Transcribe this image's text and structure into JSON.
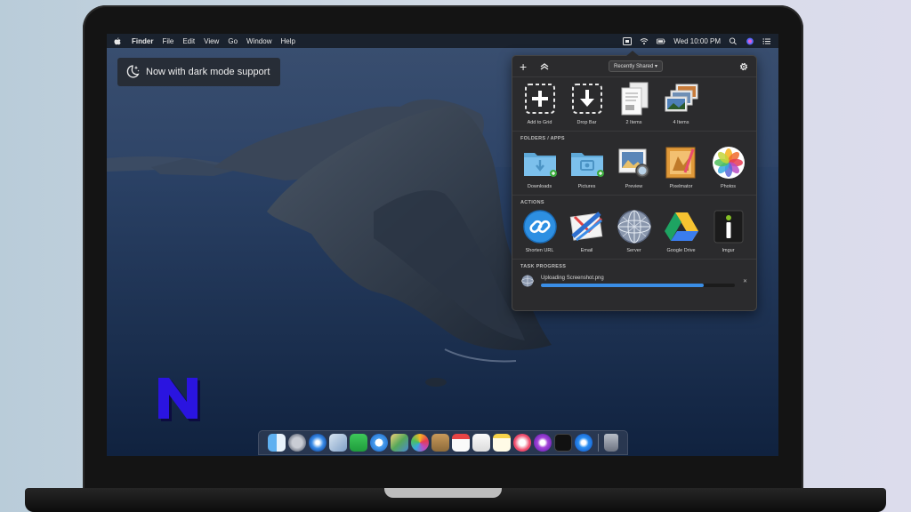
{
  "menubar": {
    "app": "Finder",
    "items": [
      "File",
      "Edit",
      "View",
      "Go",
      "Window",
      "Help"
    ],
    "clock": "Wed 10:00 PM"
  },
  "badge": {
    "text": "Now with dark mode support",
    "icon": "moon-sparkle-icon"
  },
  "panel": {
    "dropdown": "Recently Shared ▾",
    "top_items": [
      {
        "label": "Add to Grid",
        "icon": "plus-dashed-icon"
      },
      {
        "label": "Drop Bar",
        "icon": "download-dashed-icon"
      },
      {
        "label": "2 Items",
        "icon": "documents-icon"
      },
      {
        "label": "4 Items",
        "icon": "photos-stack-icon"
      }
    ],
    "folders_title": "FOLDERS / APPS",
    "folders": [
      {
        "label": "Downloads",
        "icon": "downloads-folder-icon"
      },
      {
        "label": "Pictures",
        "icon": "pictures-folder-icon"
      },
      {
        "label": "Preview",
        "icon": "preview-app-icon"
      },
      {
        "label": "Pixelmator",
        "icon": "pixelmator-app-icon"
      },
      {
        "label": "Photos",
        "icon": "photos-app-icon"
      }
    ],
    "actions_title": "ACTIONS",
    "actions": [
      {
        "label": "Shorten URL",
        "icon": "link-icon"
      },
      {
        "label": "Email",
        "icon": "email-icon"
      },
      {
        "label": "Server",
        "icon": "server-icon"
      },
      {
        "label": "Google Drive",
        "icon": "google-drive-icon"
      },
      {
        "label": "Imgur",
        "icon": "imgur-icon"
      }
    ],
    "progress_title": "TASK PROGRESS",
    "task": {
      "label": "Uploading Screenshot.png",
      "progress": 0.84
    }
  },
  "colors": {
    "accent": "#3a8ee6",
    "panel_bg": "#2b2b2d",
    "logo": "#2a14e0"
  },
  "logo": {
    "letter": "N"
  }
}
